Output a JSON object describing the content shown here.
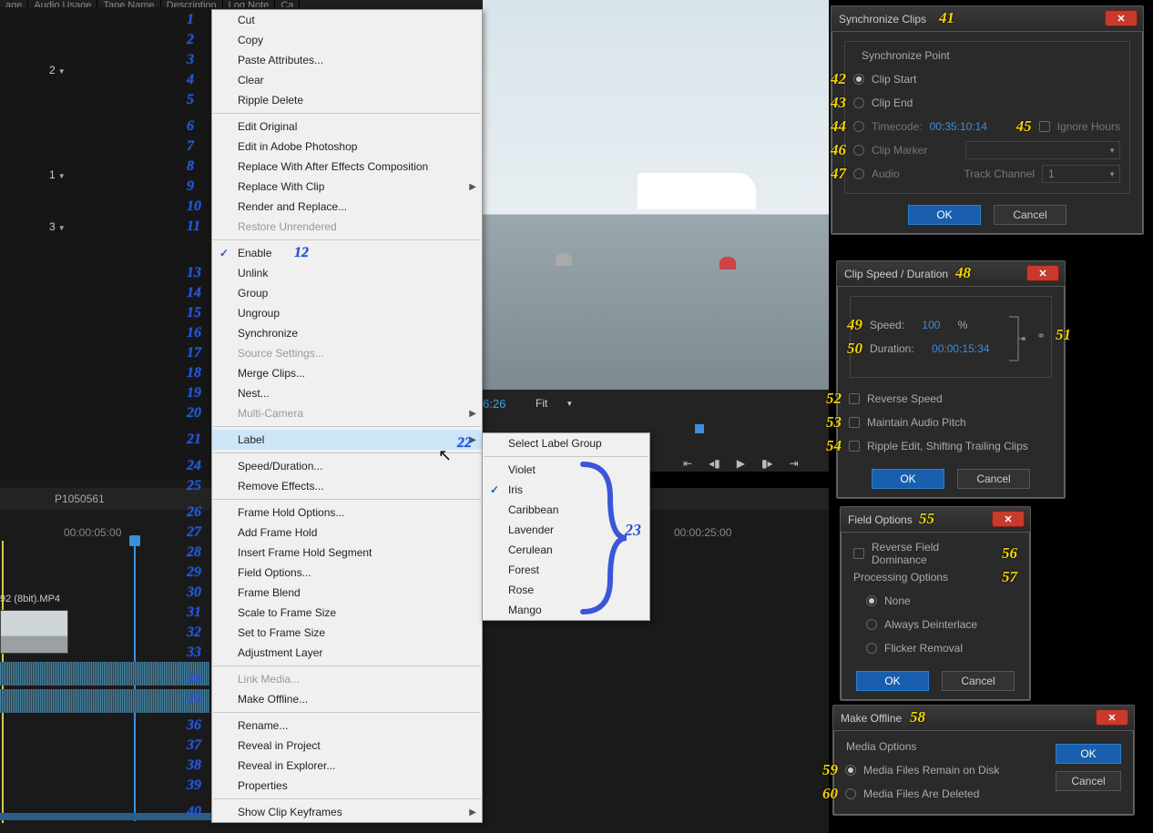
{
  "header_cells": [
    "age",
    "Audio Usage",
    "Tape Name",
    "Description",
    "Log Note",
    "Ca"
  ],
  "left_dropdowns": [
    "2",
    "1",
    "3"
  ],
  "ctx": {
    "items": [
      {
        "n": "1",
        "label": "Cut"
      },
      {
        "n": "2",
        "label": "Copy"
      },
      {
        "n": "3",
        "label": "Paste Attributes..."
      },
      {
        "n": "4",
        "label": "Clear"
      },
      {
        "n": "5",
        "label": "Ripple Delete"
      },
      {
        "sep": true
      },
      {
        "n": "6",
        "label": "Edit Original"
      },
      {
        "n": "7",
        "label": "Edit in Adobe Photoshop"
      },
      {
        "n": "8",
        "label": "Replace With After Effects Composition"
      },
      {
        "n": "9",
        "label": "Replace With Clip",
        "arrow": true
      },
      {
        "n": "10",
        "label": "Render and Replace..."
      },
      {
        "n": "11",
        "label": "Restore Unrendered",
        "disabled": true
      },
      {
        "sep": true
      },
      {
        "n": "12",
        "label": "Enable",
        "check": true,
        "numright": true
      },
      {
        "n": "13",
        "label": "Unlink"
      },
      {
        "n": "14",
        "label": "Group"
      },
      {
        "n": "15",
        "label": "Ungroup"
      },
      {
        "n": "16",
        "label": "Synchronize"
      },
      {
        "n": "17",
        "label": "Source Settings...",
        "disabled": true
      },
      {
        "n": "18",
        "label": "Merge Clips..."
      },
      {
        "n": "19",
        "label": "Nest..."
      },
      {
        "n": "20",
        "label": "Multi-Camera",
        "arrow": true,
        "disabled": true
      },
      {
        "sep": true
      },
      {
        "n": "21",
        "label": "Label",
        "arrow": true,
        "highlight": true
      },
      {
        "sep": true
      },
      {
        "n": "24",
        "label": "Speed/Duration..."
      },
      {
        "n": "25",
        "label": "Remove Effects..."
      },
      {
        "sep": true
      },
      {
        "n": "26",
        "label": "Frame Hold Options..."
      },
      {
        "n": "27",
        "label": "Add Frame Hold"
      },
      {
        "n": "28",
        "label": "Insert Frame Hold Segment"
      },
      {
        "n": "29",
        "label": "Field Options..."
      },
      {
        "n": "30",
        "label": "Frame Blend"
      },
      {
        "n": "31",
        "label": "Scale to Frame Size"
      },
      {
        "n": "32",
        "label": "Set to Frame Size"
      },
      {
        "n": "33",
        "label": "Adjustment Layer"
      },
      {
        "sep": true
      },
      {
        "n": "34",
        "label": "Link Media...",
        "disabled": true
      },
      {
        "n": "35",
        "label": "Make Offline..."
      },
      {
        "sep": true
      },
      {
        "n": "36",
        "label": "Rename..."
      },
      {
        "n": "37",
        "label": "Reveal in Project"
      },
      {
        "n": "38",
        "label": "Reveal in Explorer..."
      },
      {
        "n": "39",
        "label": "Properties"
      },
      {
        "sep": true
      },
      {
        "n": "40",
        "label": "Show Clip Keyframes",
        "arrow": true
      }
    ]
  },
  "submenu": {
    "title_n": "22",
    "title": "Select Label Group",
    "brace_n": "23",
    "colors": [
      "Violet",
      "Iris",
      "Caribbean",
      "Lavender",
      "Cerulean",
      "Forest",
      "Rose",
      "Mango"
    ],
    "checked": "Iris"
  },
  "preview": {
    "timecode_suffix": "6:26",
    "fit": "Fit"
  },
  "timeline": {
    "seq_name": "P1050561",
    "ticks": [
      "00:00:05:00",
      "00:00:25:00"
    ],
    "clip_name": "92 (8bit).MP4"
  },
  "dlg_sync": {
    "n": "41",
    "title": "Synchronize Clips",
    "group": "Synchronize Point",
    "r1": {
      "n": "42",
      "label": "Clip Start"
    },
    "r2": {
      "n": "43",
      "label": "Clip End"
    },
    "r3": {
      "n": "44",
      "label": "Timecode:",
      "val": "00:35:10:14"
    },
    "ignore": {
      "n": "45",
      "label": "Ignore Hours"
    },
    "r4": {
      "n": "46",
      "label": "Clip Marker"
    },
    "r5": {
      "n": "47",
      "label": "Audio",
      "tc": "Track Channel",
      "tcval": "1"
    },
    "ok": "OK",
    "cancel": "Cancel"
  },
  "dlg_speed": {
    "n": "48",
    "title": "Clip Speed / Duration",
    "speed": {
      "n": "49",
      "label": "Speed:",
      "val": "100",
      "unit": "%"
    },
    "dur": {
      "n": "50",
      "label": "Duration:",
      "val": "00:00:15:34"
    },
    "link": {
      "n": "51"
    },
    "c1": {
      "n": "52",
      "label": "Reverse Speed"
    },
    "c2": {
      "n": "53",
      "label": "Maintain Audio Pitch"
    },
    "c3": {
      "n": "54",
      "label": "Ripple Edit, Shifting Trailing Clips"
    },
    "ok": "OK",
    "cancel": "Cancel"
  },
  "dlg_field": {
    "n": "55",
    "title": "Field Options",
    "c1": {
      "n": "56",
      "label": "Reverse Field Dominance"
    },
    "group": {
      "n": "57",
      "label": "Processing Options"
    },
    "r1": "None",
    "r2": "Always Deinterlace",
    "r3": "Flicker Removal",
    "ok": "OK",
    "cancel": "Cancel"
  },
  "dlg_offline": {
    "n": "58",
    "title": "Make Offline",
    "group": "Media Options",
    "r1": {
      "n": "59",
      "label": "Media Files Remain on Disk"
    },
    "r2": {
      "n": "60",
      "label": "Media Files Are Deleted"
    },
    "ok": "OK",
    "cancel": "Cancel"
  }
}
